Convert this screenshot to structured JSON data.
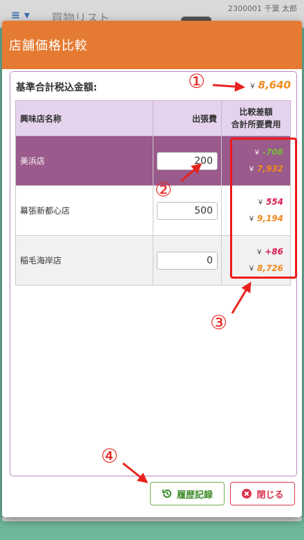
{
  "app": {
    "title": "買物リスト",
    "user": "2300001 千葉 太郎",
    "menu_icon": "hamburger-icon"
  },
  "modal": {
    "title": "店舗価格比較"
  },
  "base": {
    "label": "基準合計税込金額:",
    "currency": "￥",
    "value": "8,640"
  },
  "table": {
    "headers": {
      "store": "興味店名称",
      "fee": "出張費",
      "compare_line1": "比較差額",
      "compare_line2": "合計所要費用"
    },
    "rows": [
      {
        "store": "美浜店",
        "fee": "200",
        "diff": "-708",
        "total": "7,932",
        "selected": true
      },
      {
        "store": "幕張新都心店",
        "fee": "500",
        "diff": "554",
        "total": "9,194"
      },
      {
        "store": "稲毛海岸店",
        "fee": "0",
        "diff": "+86",
        "total": "8,726"
      }
    ]
  },
  "buttons": {
    "history": "履歴記録",
    "close": "閉じる"
  },
  "annotations": {
    "a1": "①",
    "a2": "②",
    "a3": "③",
    "a4": "④"
  },
  "colors": {
    "header": "#e57b32",
    "selected_row": "#9a5a8c",
    "annotation": "#e8231f"
  }
}
